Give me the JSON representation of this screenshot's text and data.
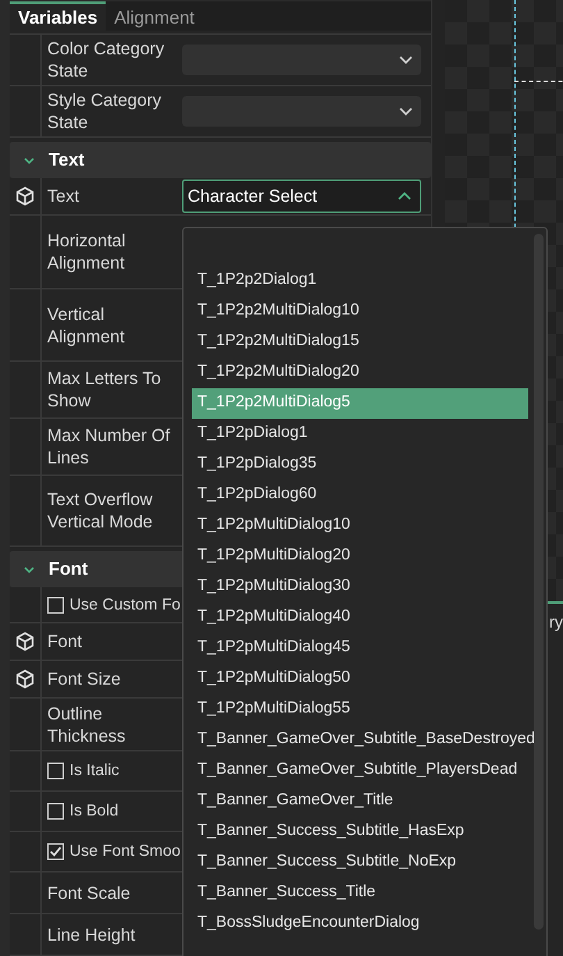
{
  "tabs": [
    {
      "label": "Variables",
      "selected": true
    },
    {
      "label": "Alignment",
      "selected": false
    }
  ],
  "top_rows": [
    {
      "label": "Color Category State",
      "kind": "combo"
    },
    {
      "label": "Style Category State",
      "kind": "combo"
    }
  ],
  "sections": [
    {
      "title": "Text",
      "expanded": true,
      "rows": [
        {
          "label": "Text",
          "kind": "combo",
          "bound": true,
          "value": "Character Select",
          "open": true
        },
        {
          "label": "Horizontal Alignment",
          "kind": "plain",
          "bound": false
        },
        {
          "label": "Vertical Alignment",
          "kind": "plain",
          "bound": false
        },
        {
          "label": "Max Letters To Show",
          "kind": "plain",
          "bound": false
        },
        {
          "label": "Max Number Of Lines",
          "kind": "plain",
          "bound": false
        },
        {
          "label": "Text Overflow Vertical Mode",
          "kind": "plain",
          "bound": false
        }
      ]
    },
    {
      "title": "Font",
      "expanded": true,
      "rows": [
        {
          "label": "Use Custom Fo",
          "kind": "checkbox",
          "checked": false
        },
        {
          "label": "Font",
          "kind": "plain",
          "bound": true
        },
        {
          "label": "Font Size",
          "kind": "plain",
          "bound": true
        },
        {
          "label": "Outline Thickness",
          "kind": "plain",
          "bound": false
        },
        {
          "label": "Is Italic",
          "kind": "checkbox",
          "checked": false
        },
        {
          "label": "Is Bold",
          "kind": "checkbox",
          "checked": false
        },
        {
          "label": "Use Font Smoo",
          "kind": "checkbox",
          "checked": true
        },
        {
          "label": "Font Scale",
          "kind": "plain",
          "bound": false
        },
        {
          "label": "Line Height",
          "kind": "plain",
          "bound": false
        }
      ]
    }
  ],
  "background_tab": {
    "label": "ry"
  },
  "dropdown_items": [
    {
      "label": "T_1P2p2Dialog1",
      "selected": false
    },
    {
      "label": "T_1P2p2MultiDialog10",
      "selected": false
    },
    {
      "label": "T_1P2p2MultiDialog15",
      "selected": false
    },
    {
      "label": "T_1P2p2MultiDialog20",
      "selected": false
    },
    {
      "label": "T_1P2p2MultiDialog5",
      "selected": true
    },
    {
      "label": "T_1P2pDialog1",
      "selected": false
    },
    {
      "label": "T_1P2pDialog35",
      "selected": false
    },
    {
      "label": "T_1P2pDialog60",
      "selected": false
    },
    {
      "label": "T_1P2pMultiDialog10",
      "selected": false
    },
    {
      "label": "T_1P2pMultiDialog20",
      "selected": false
    },
    {
      "label": "T_1P2pMultiDialog30",
      "selected": false
    },
    {
      "label": "T_1P2pMultiDialog40",
      "selected": false
    },
    {
      "label": "T_1P2pMultiDialog45",
      "selected": false
    },
    {
      "label": "T_1P2pMultiDialog50",
      "selected": false
    },
    {
      "label": "T_1P2pMultiDialog55",
      "selected": false
    },
    {
      "label": "T_Banner_GameOver_Subtitle_BaseDestroyed",
      "selected": false
    },
    {
      "label": "T_Banner_GameOver_Subtitle_PlayersDead",
      "selected": false
    },
    {
      "label": "T_Banner_GameOver_Title",
      "selected": false
    },
    {
      "label": "T_Banner_Success_Subtitle_HasExp",
      "selected": false
    },
    {
      "label": "T_Banner_Success_Subtitle_NoExp",
      "selected": false
    },
    {
      "label": "T_Banner_Success_Title",
      "selected": false
    },
    {
      "label": "T_BossSludgeEncounterDialog",
      "selected": false
    }
  ]
}
